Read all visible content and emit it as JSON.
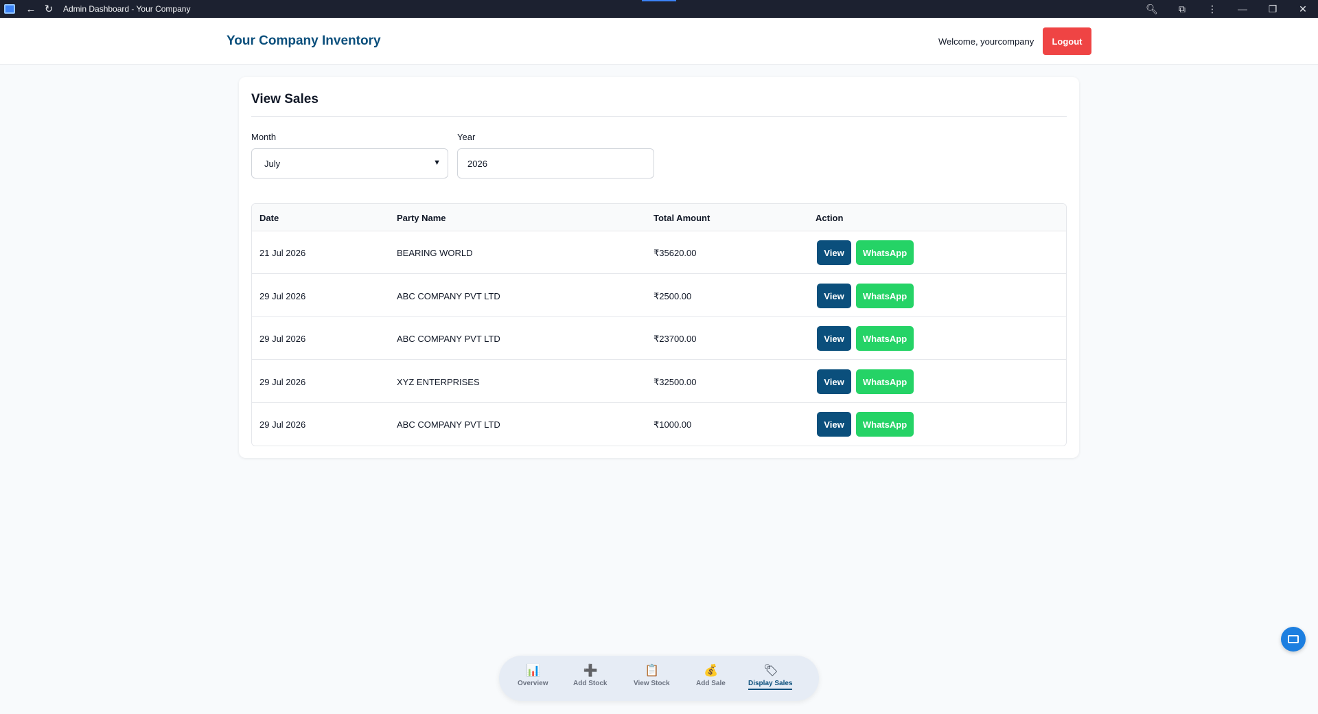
{
  "browser": {
    "title": "Admin Dashboard - Your Company",
    "icons": [
      "back-arrow-icon",
      "reload-icon",
      "zoom-icon",
      "extensions-icon",
      "more-icon",
      "minimize-icon",
      "restore-icon",
      "close-icon"
    ]
  },
  "header": {
    "brand": "Your Company Inventory",
    "welcome": "Welcome, yourcompany",
    "logout_label": "Logout"
  },
  "view_sales": {
    "title": "View Sales",
    "month_label": "Month",
    "month_value": "July",
    "year_label": "Year",
    "year_value": "2026"
  },
  "table": {
    "columns": [
      "Date",
      "Party Name",
      "Total Amount",
      "Action"
    ],
    "view_label": "View",
    "whatsapp_label": "WhatsApp",
    "rows": [
      {
        "date": "21 Jul 2026",
        "party": "BEARING WORLD",
        "amount": "₹35620.00"
      },
      {
        "date": "29 Jul 2026",
        "party": "ABC COMPANY PVT LTD",
        "amount": "₹2500.00"
      },
      {
        "date": "29 Jul 2026",
        "party": "ABC COMPANY PVT LTD",
        "amount": "₹23700.00"
      },
      {
        "date": "29 Jul 2026",
        "party": "XYZ ENTERPRISES",
        "amount": "₹32500.00"
      },
      {
        "date": "29 Jul 2026",
        "party": "ABC COMPANY PVT LTD",
        "amount": "₹1000.00"
      }
    ]
  },
  "bottom_nav": {
    "items": [
      {
        "label": "Overview",
        "icon": "bar-chart-icon",
        "glyph": "📊"
      },
      {
        "label": "Add Stock",
        "icon": "plus-icon",
        "glyph": "➕"
      },
      {
        "label": "View Stock",
        "icon": "clipboard-icon",
        "glyph": "📋"
      },
      {
        "label": "Add Sale",
        "icon": "money-bag-icon",
        "glyph": "💰"
      },
      {
        "label": "Display Sales",
        "icon": "tag-icon",
        "glyph": "🏷"
      }
    ],
    "active": "Display Sales"
  },
  "colors": {
    "brand": "#0b4f7c",
    "logout": "#ef4444",
    "whatsapp": "#25d366"
  }
}
